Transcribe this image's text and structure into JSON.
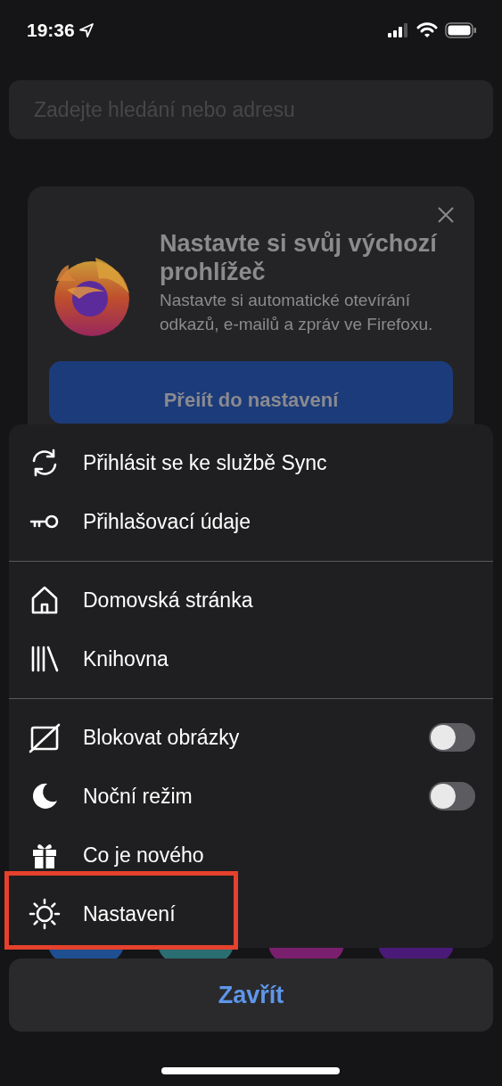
{
  "status_bar": {
    "time": "19:36"
  },
  "search": {
    "placeholder": "Zadejte hledání nebo adresu"
  },
  "promo_card": {
    "title": "Nastavte si svůj výchozí prohlížeč",
    "text": "Nastavte si automatické otevírání odkazů, e-mailů a zpráv ve Firefoxu.",
    "button": "Přeiít do nastavení"
  },
  "top_sites": [
    {
      "color": "#1f4f91"
    },
    {
      "color": "#2b6e72"
    },
    {
      "color": "#7a1f6e"
    },
    {
      "color": "#4a1a78"
    }
  ],
  "menu": {
    "groups": [
      [
        {
          "kind": "plain",
          "label": "Přihlásit se ke službě Sync",
          "highlighted": false
        },
        {
          "kind": "plain",
          "label": "Přihlašovací údaje",
          "highlighted": false
        }
      ],
      [
        {
          "kind": "plain",
          "label": "Domovská stránka",
          "highlighted": false
        },
        {
          "kind": "plain",
          "label": "Knihovna",
          "highlighted": false
        }
      ],
      [
        {
          "kind": "toggle",
          "label": "Blokovat obrázky",
          "on": false,
          "highlighted": false
        },
        {
          "kind": "toggle",
          "label": "Noční režim",
          "on": false,
          "highlighted": false
        },
        {
          "kind": "plain",
          "label": "Co je nového",
          "highlighted": false
        },
        {
          "kind": "plain",
          "label": "Nastavení",
          "highlighted": true
        }
      ]
    ]
  },
  "close_button": "Zavřít"
}
